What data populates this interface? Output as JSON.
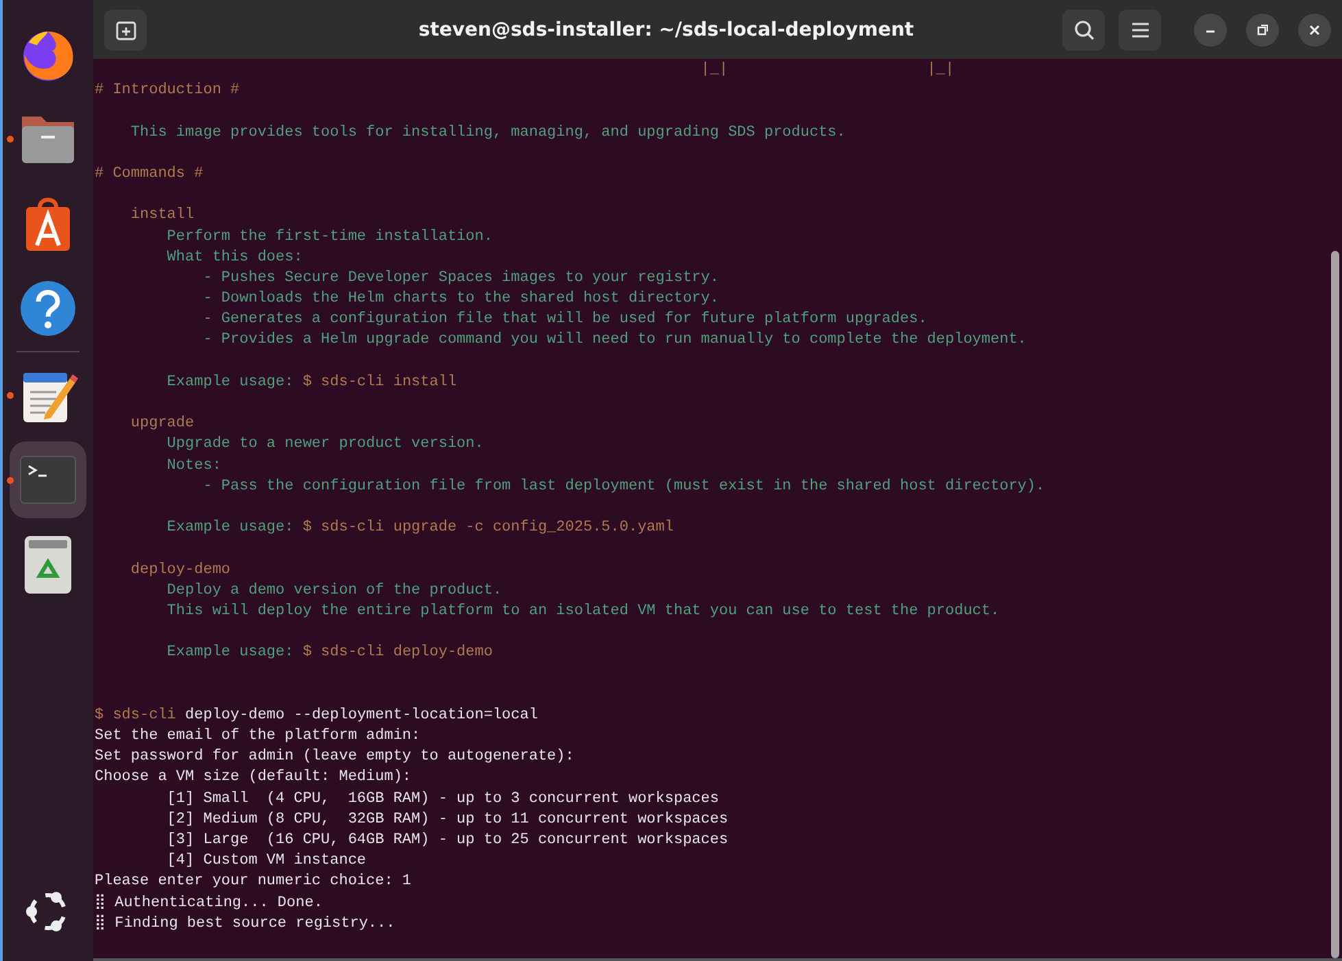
{
  "dock": {
    "items": [
      {
        "kind": "browser",
        "running": false,
        "selected": false
      },
      {
        "kind": "files",
        "running": true,
        "selected": false
      },
      {
        "kind": "store",
        "running": false,
        "selected": false
      },
      {
        "kind": "help",
        "running": false,
        "selected": false
      },
      {
        "kind": "separator"
      },
      {
        "kind": "editor",
        "running": true,
        "selected": false
      },
      {
        "kind": "terminal",
        "running": true,
        "selected": true
      },
      {
        "kind": "trash",
        "running": false,
        "selected": false
      }
    ],
    "apps_button": {
      "kind": "ubuntu"
    }
  },
  "window": {
    "title": "steven@sds-installer: ~/sds-local-deployment"
  },
  "terminal": {
    "lines": [
      {
        "kind": "text",
        "segments": [
          {
            "kind": "heading",
            "text": "                                                                   |_|                      |_|"
          }
        ]
      },
      {
        "kind": "text",
        "segments": [
          {
            "kind": "heading",
            "text": "# Introduction #"
          }
        ]
      },
      {
        "kind": "blank"
      },
      {
        "kind": "text",
        "segments": [
          {
            "kind": "body",
            "text": "    This image provides tools for installing, managing, and upgrading SDS products."
          }
        ]
      },
      {
        "kind": "blank"
      },
      {
        "kind": "text",
        "segments": [
          {
            "kind": "heading",
            "text": "# Commands #"
          }
        ]
      },
      {
        "kind": "blank"
      },
      {
        "kind": "text",
        "segments": [
          {
            "kind": "heading",
            "text": "    install"
          }
        ]
      },
      {
        "kind": "text",
        "segments": [
          {
            "kind": "body",
            "text": "        Perform the first-time installation."
          }
        ]
      },
      {
        "kind": "text",
        "segments": [
          {
            "kind": "body",
            "text": "        What this does:"
          }
        ]
      },
      {
        "kind": "text",
        "segments": [
          {
            "kind": "body",
            "text": "            - Pushes Secure Developer Spaces images to your registry."
          }
        ]
      },
      {
        "kind": "text",
        "segments": [
          {
            "kind": "body",
            "text": "            - Downloads the Helm charts to the shared host directory."
          }
        ]
      },
      {
        "kind": "text",
        "segments": [
          {
            "kind": "body",
            "text": "            - Generates a configuration file that will be used for future platform upgrades."
          }
        ]
      },
      {
        "kind": "text",
        "segments": [
          {
            "kind": "body",
            "text": "            - Provides a Helm upgrade command you will need to run manually to complete the deployment."
          }
        ]
      },
      {
        "kind": "blank"
      },
      {
        "kind": "text",
        "segments": [
          {
            "kind": "body",
            "text": "        Example usage: "
          },
          {
            "kind": "heading",
            "text": "$ sds-cli install"
          }
        ]
      },
      {
        "kind": "blank"
      },
      {
        "kind": "text",
        "segments": [
          {
            "kind": "heading",
            "text": "    upgrade"
          }
        ]
      },
      {
        "kind": "text",
        "segments": [
          {
            "kind": "body",
            "text": "        Upgrade to a newer product version."
          }
        ]
      },
      {
        "kind": "text",
        "segments": [
          {
            "kind": "body",
            "text": "        Notes:"
          }
        ]
      },
      {
        "kind": "text",
        "segments": [
          {
            "kind": "body",
            "text": "            - Pass the configuration file from last deployment (must exist in the shared host directory)."
          }
        ]
      },
      {
        "kind": "blank"
      },
      {
        "kind": "text",
        "segments": [
          {
            "kind": "body",
            "text": "        Example usage: "
          },
          {
            "kind": "heading",
            "text": "$ sds-cli upgrade -c config_2025.5.0.yaml"
          }
        ]
      },
      {
        "kind": "blank"
      },
      {
        "kind": "text",
        "segments": [
          {
            "kind": "heading",
            "text": "    deploy-demo"
          }
        ]
      },
      {
        "kind": "text",
        "segments": [
          {
            "kind": "body",
            "text": "        Deploy a demo version of the product."
          }
        ]
      },
      {
        "kind": "text",
        "segments": [
          {
            "kind": "body",
            "text": "        This will deploy the entire platform to an isolated VM that you can use to test the product."
          }
        ]
      },
      {
        "kind": "blank"
      },
      {
        "kind": "text",
        "segments": [
          {
            "kind": "body",
            "text": "        Example usage: "
          },
          {
            "kind": "heading",
            "text": "$ sds-cli deploy-demo"
          }
        ]
      },
      {
        "kind": "blank"
      },
      {
        "kind": "blank"
      },
      {
        "kind": "text",
        "segments": [
          {
            "kind": "heading",
            "text": "$ sds-cli"
          },
          {
            "kind": "output",
            "text": " deploy-demo --deployment-location=local"
          }
        ]
      },
      {
        "kind": "text",
        "segments": [
          {
            "kind": "output",
            "text": "Set the email of the platform admin:"
          }
        ]
      },
      {
        "kind": "text",
        "segments": [
          {
            "kind": "output",
            "text": "Set password for admin (leave empty to autogenerate):"
          }
        ]
      },
      {
        "kind": "text",
        "segments": [
          {
            "kind": "output",
            "text": "Choose a VM size (default: Medium):"
          }
        ]
      },
      {
        "kind": "text",
        "segments": [
          {
            "kind": "output",
            "text": "        [1] Small  (4 CPU,  16GB RAM) - up to 3 concurrent workspaces"
          }
        ]
      },
      {
        "kind": "text",
        "segments": [
          {
            "kind": "output",
            "text": "        [2] Medium (8 CPU,  32GB RAM) - up to 11 concurrent workspaces"
          }
        ]
      },
      {
        "kind": "text",
        "segments": [
          {
            "kind": "output",
            "text": "        [3] Large  (16 CPU, 64GB RAM) - up to 25 concurrent workspaces"
          }
        ]
      },
      {
        "kind": "text",
        "segments": [
          {
            "kind": "output",
            "text": "        [4] Custom VM instance"
          }
        ]
      },
      {
        "kind": "text",
        "segments": [
          {
            "kind": "output",
            "text": "Please enter your numeric choice: 1"
          }
        ]
      },
      {
        "kind": "text",
        "segments": [
          {
            "kind": "output",
            "text": "⣿ Authenticating... Done."
          }
        ]
      },
      {
        "kind": "text",
        "segments": [
          {
            "kind": "output",
            "text": "⣿ Finding best source registry..."
          }
        ]
      }
    ]
  }
}
